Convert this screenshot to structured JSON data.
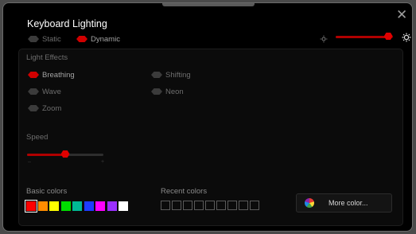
{
  "title": "Keyboard  Lighting",
  "close_icon": "close-icon",
  "mode": {
    "static_label": "Static",
    "dynamic_label": "Dynamic",
    "selected": "Dynamic"
  },
  "brightness": {
    "low_icon": "sun-small-icon",
    "high_icon": "sun-large-icon",
    "level": 0.92
  },
  "light_effects": {
    "heading": "Light Effects",
    "items": [
      {
        "label": "Breathing",
        "selected": true
      },
      {
        "label": "Shifting",
        "selected": false
      },
      {
        "label": "Wave",
        "selected": false
      },
      {
        "label": "Neon",
        "selected": false
      },
      {
        "label": "Zoom",
        "selected": false
      }
    ]
  },
  "speed": {
    "heading": "Speed",
    "level": 0.5,
    "min_label": "–",
    "max_label": "+"
  },
  "basic_colors": {
    "heading": "Basic colors",
    "swatches": [
      "#ff0000",
      "#ff8c00",
      "#ffff00",
      "#00dd00",
      "#00b894",
      "#1e3cff",
      "#ff00ff",
      "#9b30ff",
      "#ffffff"
    ],
    "selected_index": 0
  },
  "recent_colors": {
    "heading": "Recent colors",
    "slots": 9
  },
  "more_color": {
    "label": "More color...",
    "icon": "color-wheel-icon"
  },
  "colors": {
    "accent": "#e00000",
    "background": "#000000",
    "panel": "#0b0b0b"
  }
}
